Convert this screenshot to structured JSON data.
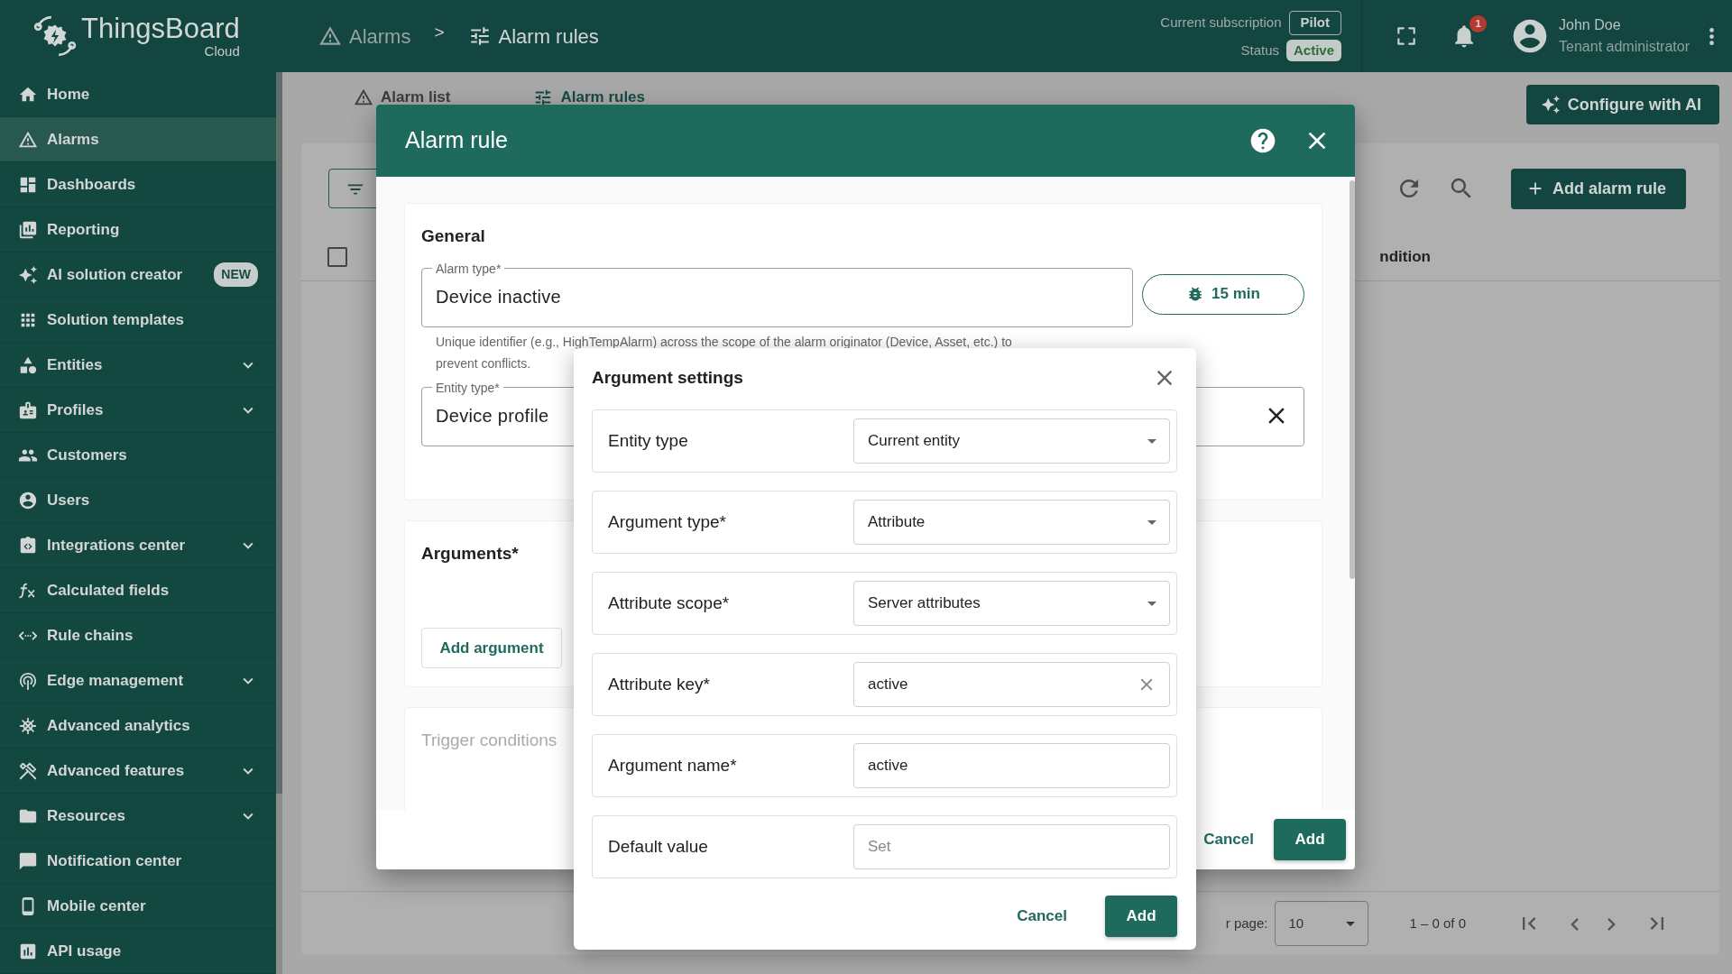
{
  "header": {
    "logo": {
      "name": "ThingsBoard",
      "edition": "Cloud"
    },
    "breadcrumb": [
      {
        "label": "Alarms",
        "current": false
      },
      {
        "label": "Alarm rules",
        "current": true
      }
    ],
    "breadcrumb_separator": ">",
    "subscription": {
      "label": "Current subscription",
      "plan": "Pilot",
      "status_label": "Status",
      "status": "Active"
    },
    "notifications": {
      "count": "1"
    },
    "user": {
      "name": "John Doe",
      "role": "Tenant administrator"
    }
  },
  "sidebar": {
    "items": [
      {
        "label": "Home",
        "selected": false,
        "expandable": false
      },
      {
        "label": "Alarms",
        "selected": true,
        "expandable": false
      },
      {
        "label": "Dashboards",
        "selected": false,
        "expandable": false
      },
      {
        "label": "Reporting",
        "selected": false,
        "expandable": false
      },
      {
        "label": "AI solution creator",
        "selected": false,
        "expandable": false,
        "badge": "NEW"
      },
      {
        "label": "Solution templates",
        "selected": false,
        "expandable": false
      },
      {
        "label": "Entities",
        "selected": false,
        "expandable": true
      },
      {
        "label": "Profiles",
        "selected": false,
        "expandable": true
      },
      {
        "label": "Customers",
        "selected": false,
        "expandable": false
      },
      {
        "label": "Users",
        "selected": false,
        "expandable": false
      },
      {
        "label": "Integrations center",
        "selected": false,
        "expandable": true
      },
      {
        "label": "Calculated fields",
        "selected": false,
        "expandable": false
      },
      {
        "label": "Rule chains",
        "selected": false,
        "expandable": false
      },
      {
        "label": "Edge management",
        "selected": false,
        "expandable": true
      },
      {
        "label": "Advanced analytics",
        "selected": false,
        "expandable": false
      },
      {
        "label": "Advanced features",
        "selected": false,
        "expandable": true
      },
      {
        "label": "Resources",
        "selected": false,
        "expandable": true
      },
      {
        "label": "Notification center",
        "selected": false,
        "expandable": false
      },
      {
        "label": "Mobile center",
        "selected": false,
        "expandable": false
      },
      {
        "label": "API usage",
        "selected": false,
        "expandable": false
      }
    ]
  },
  "tabs": [
    {
      "label": "Alarm list",
      "selected": false
    },
    {
      "label": "Alarm rules",
      "selected": true
    }
  ],
  "configure_button": "Configure with AI",
  "table": {
    "add_button": "Add alarm rule",
    "select_all": {
      "checked": false
    },
    "columns": [
      {
        "label": "ndition"
      }
    ],
    "footer": {
      "page_size_label": "r page:",
      "page_size": "10",
      "range": "1 – 0 of 0"
    }
  },
  "dialog": {
    "title": "Alarm rule",
    "general": {
      "title": "General",
      "alarm_type": {
        "label": "Alarm type*",
        "value": "Device inactive"
      },
      "interval_button": "15 min",
      "hint": "Unique identifier (e.g., HighTempAlarm) across the scope of the alarm originator (Device, Asset, etc.) to prevent conflicts.",
      "entity_type": {
        "label": "Entity type*",
        "value": "Device profile"
      }
    },
    "arguments": {
      "title": "Arguments*",
      "add_button": "Add argument"
    },
    "trigger": {
      "title": "Trigger conditions",
      "disabled": true
    },
    "buttons": {
      "cancel": "Cancel",
      "add": "Add"
    }
  },
  "popover": {
    "title": "Argument settings",
    "rows": [
      {
        "label": "Entity type",
        "kind": "select",
        "value": "Current entity"
      },
      {
        "label": "Argument type*",
        "kind": "select",
        "value": "Attribute"
      },
      {
        "label": "Attribute scope*",
        "kind": "select",
        "value": "Server attributes"
      },
      {
        "label": "Attribute key*",
        "kind": "text",
        "value": "active",
        "clearable": true
      },
      {
        "label": "Argument name*",
        "kind": "text",
        "value": "active"
      },
      {
        "label": "Default value",
        "kind": "text",
        "placeholder": "Set"
      }
    ],
    "buttons": {
      "cancel": "Cancel",
      "add": "Add"
    }
  }
}
